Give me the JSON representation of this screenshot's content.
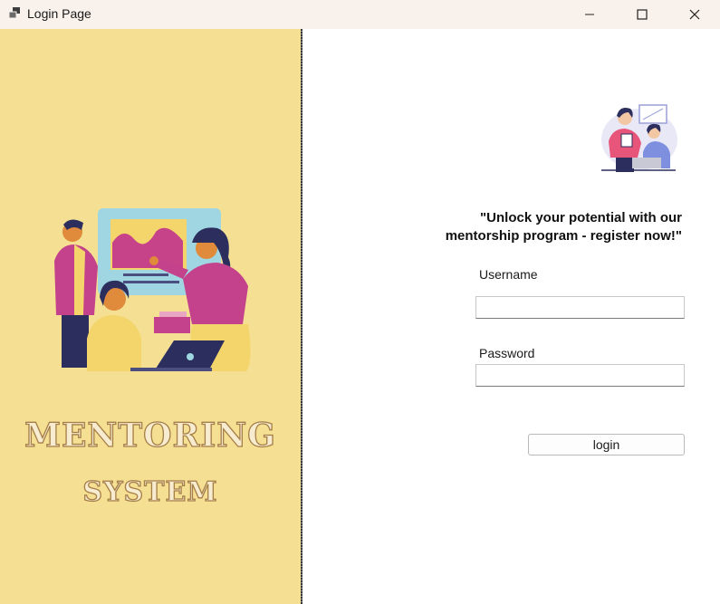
{
  "window": {
    "title": "Login Page",
    "icon": "app-window-icon",
    "controls": [
      "minimize-icon",
      "maximize-icon",
      "close-icon"
    ]
  },
  "left_panel": {
    "background": "#f5df93",
    "brand_line1": "MENTORING",
    "brand_line2": "SYSTEM",
    "illustration": "team-meeting-illustration"
  },
  "right_panel": {
    "illustration": "mentor-mentee-illustration",
    "tagline": "\"Unlock your potential with our mentorship program - register now!\"",
    "form": {
      "username_label": "Username",
      "username_value": "",
      "password_label": "Password",
      "password_value": "",
      "login_label": "login"
    }
  }
}
